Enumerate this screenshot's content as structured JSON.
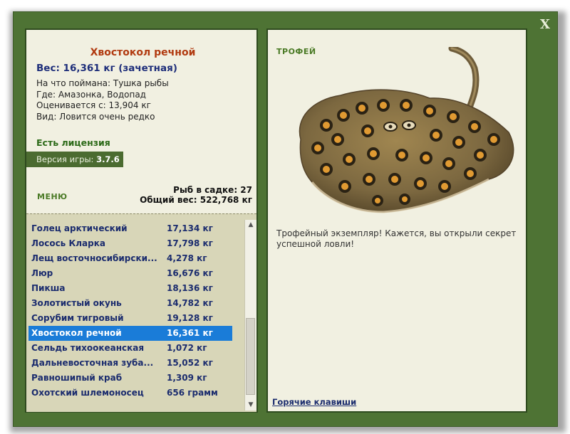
{
  "close_label": "X",
  "fish": {
    "title": "Хвостокол речной",
    "weight": "Вес: 16,361 кг (зачетная)",
    "caught_with": "На что поймана: Тушка рыбы",
    "location": "Где: Амазонка, Водопад",
    "valued_from": "Оценивается с: 13,904 кг",
    "rarity": "Вид: Ловится очень редко"
  },
  "license": "Есть лицензия",
  "version": {
    "label": "Версия игры:",
    "value": "3.7.6"
  },
  "menu_label": "МЕНЮ",
  "stats": {
    "fish_count": "Рыб в садке: 27",
    "total_weight": "Общий вес: 522,768 кг"
  },
  "catch_list": [
    {
      "name": "Голец арктический",
      "weight": "17,134 кг",
      "selected": false
    },
    {
      "name": "Лосось Кларка",
      "weight": "17,798 кг",
      "selected": false
    },
    {
      "name": "Лещ восточносибирски...",
      "weight": "4,278 кг",
      "selected": false
    },
    {
      "name": "Люр",
      "weight": "16,676 кг",
      "selected": false
    },
    {
      "name": "Пикша",
      "weight": "18,136 кг",
      "selected": false
    },
    {
      "name": "Золотистый окунь",
      "weight": "14,782 кг",
      "selected": false
    },
    {
      "name": "Сорубим тигровый",
      "weight": "19,128 кг",
      "selected": false
    },
    {
      "name": "Хвостокол речной",
      "weight": "16,361 кг",
      "selected": true
    },
    {
      "name": "Сельдь тихоокеанская",
      "weight": "1,072 кг",
      "selected": false
    },
    {
      "name": "Дальневосточная зуба...",
      "weight": "15,052 кг",
      "selected": false
    },
    {
      "name": "Равношипый краб",
      "weight": "1,309 кг",
      "selected": false
    },
    {
      "name": "Охотский шлемоносец",
      "weight": "656 грамм",
      "selected": false
    }
  ],
  "scroll": {
    "up_icon": "▲",
    "down_icon": "▼"
  },
  "trophy_label": "ТРОФЕЙ",
  "trophy_description": "Трофейный экземпляр! Кажется, вы открыли секрет успешной ловли!",
  "hotkeys_link": "Горячие клавиши",
  "colors": {
    "frame": "#4e7334",
    "panel": "#f1f0e1",
    "list_bg": "#d8d6b8",
    "selection": "#1a7cd8",
    "title_red": "#b13a10",
    "text_blue": "#1e2e7a",
    "label_green": "#4a7a25"
  }
}
